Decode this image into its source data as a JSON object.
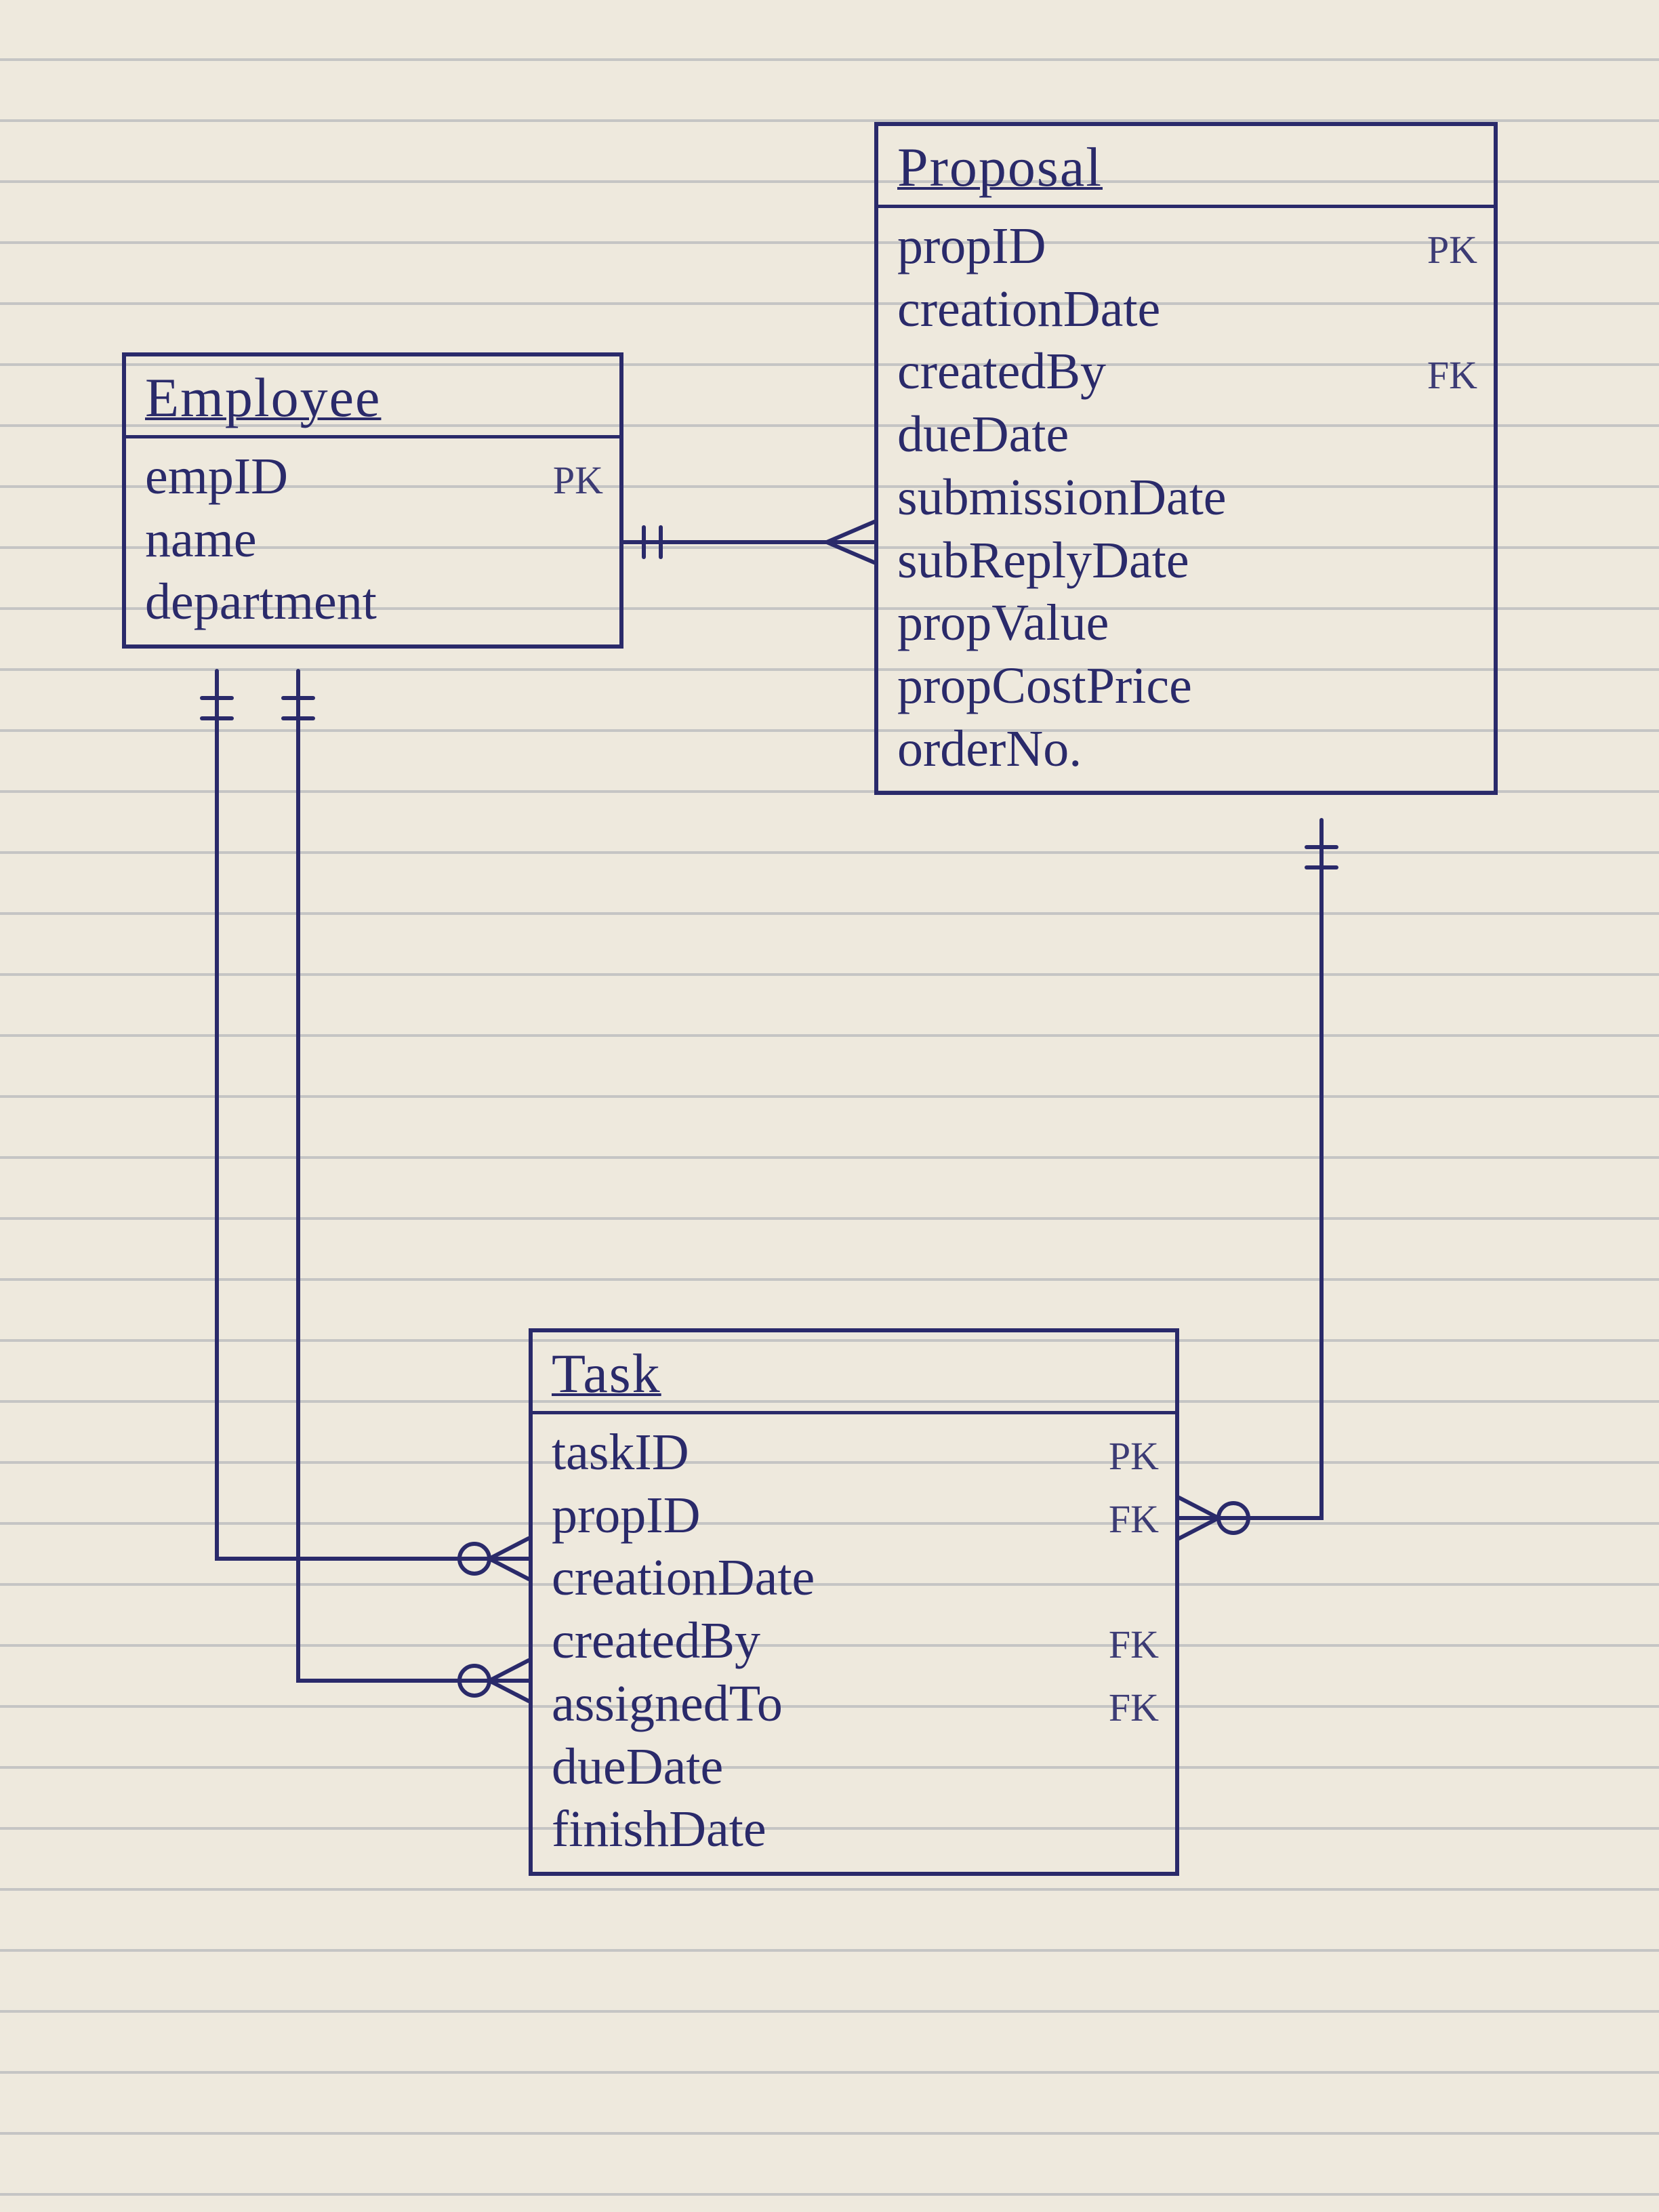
{
  "entities": {
    "employee": {
      "title": "Employee",
      "attrs": [
        {
          "name": "empID",
          "key": "PK"
        },
        {
          "name": "name",
          "key": ""
        },
        {
          "name": "department",
          "key": ""
        }
      ]
    },
    "proposal": {
      "title": "Proposal",
      "attrs": [
        {
          "name": "propID",
          "key": "PK"
        },
        {
          "name": "creationDate",
          "key": ""
        },
        {
          "name": "createdBy",
          "key": "FK"
        },
        {
          "name": "dueDate",
          "key": ""
        },
        {
          "name": "submissionDate",
          "key": ""
        },
        {
          "name": "subReplyDate",
          "key": ""
        },
        {
          "name": "propValue",
          "key": ""
        },
        {
          "name": "propCostPrice",
          "key": ""
        },
        {
          "name": "orderNo.",
          "key": ""
        }
      ]
    },
    "task": {
      "title": "Task",
      "attrs": [
        {
          "name": "taskID",
          "key": "PK"
        },
        {
          "name": "propID",
          "key": "FK"
        },
        {
          "name": "creationDate",
          "key": ""
        },
        {
          "name": "createdBy",
          "key": "FK"
        },
        {
          "name": "assignedTo",
          "key": "FK"
        },
        {
          "name": "dueDate",
          "key": ""
        },
        {
          "name": "finishDate",
          "key": ""
        }
      ]
    }
  },
  "relationships": [
    {
      "from": "employee",
      "to": "proposal",
      "from_card": "one-and-only-one",
      "to_card": "one-or-many"
    },
    {
      "from": "employee",
      "to": "task",
      "from_card": "one-and-only-one",
      "to_card": "zero-or-many",
      "note": "createdBy"
    },
    {
      "from": "employee",
      "to": "task",
      "from_card": "one-and-only-one",
      "to_card": "zero-or-many",
      "note": "assignedTo"
    },
    {
      "from": "proposal",
      "to": "task",
      "from_card": "one-and-only-one",
      "to_card": "zero-or-many"
    }
  ]
}
